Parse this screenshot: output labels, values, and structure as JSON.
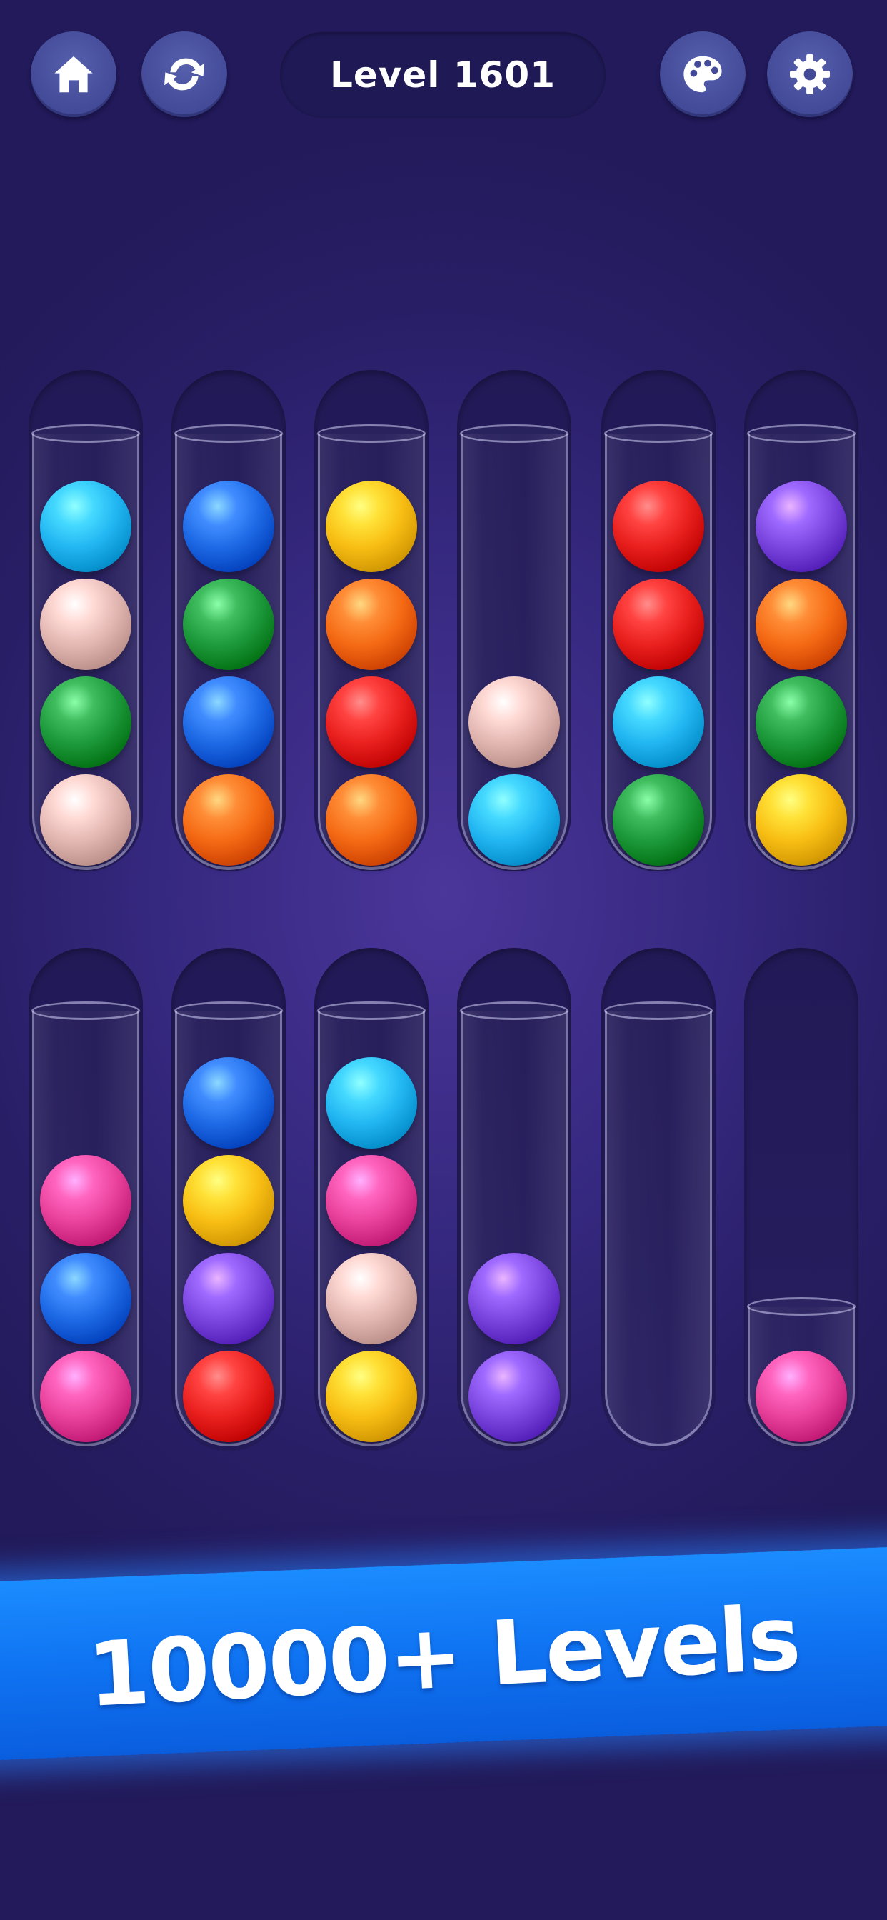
{
  "header": {
    "level_label": "Level 1601"
  },
  "icons": {
    "home": "home-icon",
    "restart": "restart-icon",
    "theme": "palette-icon",
    "settings": "gear-icon"
  },
  "palette": {
    "cyan": "#22b6f2",
    "blue": "#1e6ae6",
    "pink_beige": "#e3b7b2",
    "green": "#1d9a3c",
    "orange": "#f56a14",
    "yellow": "#f8be14",
    "red": "#e9201e",
    "purple": "#7c47e0",
    "magenta": "#e9429c"
  },
  "tubes_row1": [
    [
      "cyan",
      "pink_beige",
      "green",
      "pink_beige"
    ],
    [
      "blue",
      "green",
      "blue",
      "orange"
    ],
    [
      "yellow",
      "orange",
      "red",
      "orange"
    ],
    [
      "pink_beige",
      "cyan"
    ],
    [
      "red",
      "red",
      "cyan",
      "green"
    ],
    [
      "purple",
      "orange",
      "green",
      "yellow"
    ]
  ],
  "tubes_row2": [
    [
      "magenta",
      "blue",
      "magenta"
    ],
    [
      "blue",
      "yellow",
      "purple",
      "red"
    ],
    [
      "cyan",
      "magenta",
      "pink_beige",
      "yellow"
    ],
    [
      "purple",
      "purple"
    ],
    [],
    [
      "magenta"
    ]
  ],
  "banner": {
    "text": "10000+ Levels"
  }
}
